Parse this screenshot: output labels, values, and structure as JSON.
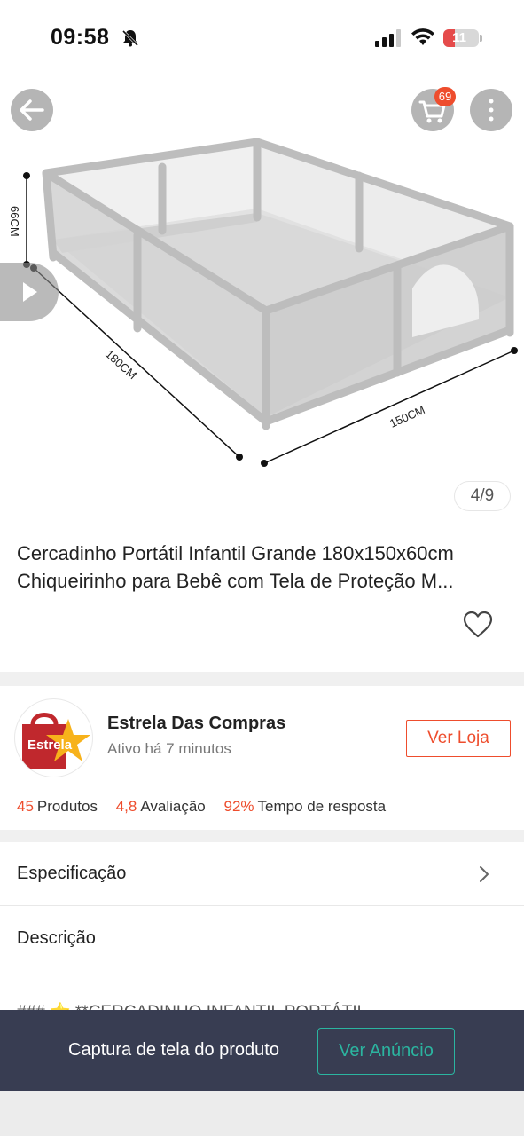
{
  "status_bar": {
    "time": "09:58",
    "battery_level": "11",
    "battery_color": "#e54b4b",
    "icons": [
      "bell-slash-icon",
      "signal-icon",
      "wifi-icon",
      "battery-icon"
    ]
  },
  "header": {
    "icons": [
      "arrow-left-icon",
      "cart-icon",
      "more-vertical-icon"
    ],
    "cart_count": "69"
  },
  "gallery": {
    "dimension_labels": {
      "height": "66CM",
      "length": "180CM",
      "width": "150CM"
    },
    "counter": "4/9"
  },
  "product": {
    "title_line1": "Cercadinho Portátil Infantil Grande 180x150x60cm",
    "title_line2": "Chiqueirinho para Bebê com Tela de Proteção  M..."
  },
  "shop": {
    "logo_text": "Estrela",
    "name": "Estrela Das Compras",
    "status": "Ativo há 7 minutos",
    "button_label": "Ver Loja",
    "stats": [
      {
        "value": "45",
        "label": "Produtos"
      },
      {
        "value": "4,8",
        "label": "Avaliação"
      },
      {
        "value": "92%",
        "label": "Tempo de resposta"
      }
    ]
  },
  "sections": {
    "specification_label": "Especificação",
    "description_label": "Descrição",
    "description_preview": "### ⭐ **CERCADINHO INFANTIL PORTÁTIL"
  },
  "banner": {
    "text": "Captura de tela do produto",
    "button_label": "Ver Anúncio"
  },
  "colors": {
    "accent": "#ee4d2d",
    "banner_bg": "#383d52",
    "banner_button": "#2bb5a0"
  }
}
